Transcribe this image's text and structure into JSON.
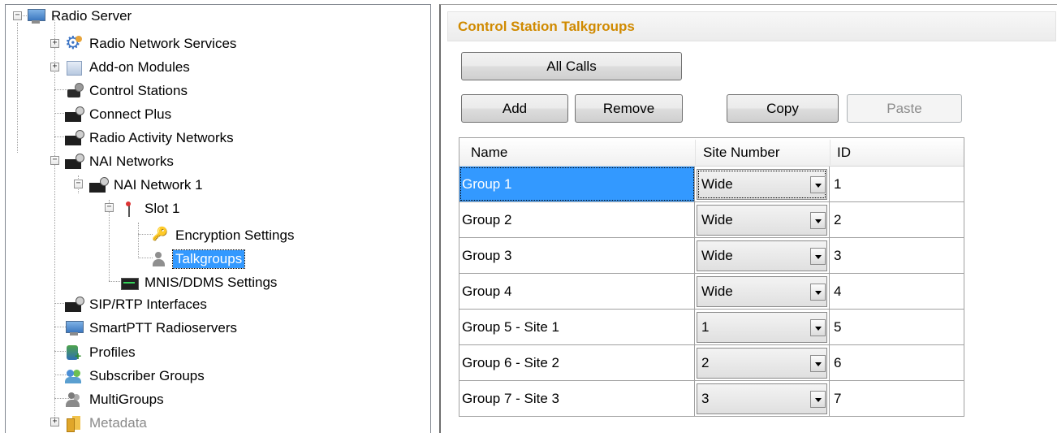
{
  "tree": {
    "radio_server": "Radio Server",
    "radio_network_services": "Radio Network Services",
    "addon_modules": "Add-on Modules",
    "control_stations": "Control Stations",
    "connect_plus": "Connect Plus",
    "radio_activity_networks": "Radio Activity Networks",
    "nai_networks": "NAI Networks",
    "nai_network_1": "NAI Network 1",
    "slot_1": "Slot 1",
    "encryption_settings": "Encryption Settings",
    "talkgroups": "Talkgroups",
    "mnis_ddms_settings": "MNIS/DDMS Settings",
    "sip_rtp_interfaces": "SIP/RTP Interfaces",
    "smartptt_radioservers": "SmartPTT Radioservers",
    "profiles": "Profiles",
    "subscriber_groups": "Subscriber Groups",
    "multigroups": "MultiGroups",
    "metadata": "Metadata"
  },
  "panel": {
    "title": "Control Station Talkgroups",
    "all_calls": "All Calls",
    "add": "Add",
    "remove": "Remove",
    "copy": "Copy",
    "paste": "Paste"
  },
  "grid": {
    "columns": [
      "Name",
      "Site Number",
      "ID"
    ],
    "rows": [
      {
        "name": "Group 1",
        "site": "Wide",
        "id": "1"
      },
      {
        "name": "Group 2",
        "site": "Wide",
        "id": "2"
      },
      {
        "name": "Group 3",
        "site": "Wide",
        "id": "3"
      },
      {
        "name": "Group 4",
        "site": "Wide",
        "id": "4"
      },
      {
        "name": "Group 5 - Site 1",
        "site": "1",
        "id": "5"
      },
      {
        "name": "Group 6 - Site 2",
        "site": "2",
        "id": "6"
      },
      {
        "name": "Group 7 - Site 3",
        "site": "3",
        "id": "7"
      }
    ]
  },
  "colors": {
    "selection": "#3399ff",
    "header_title": "#d08a00"
  }
}
